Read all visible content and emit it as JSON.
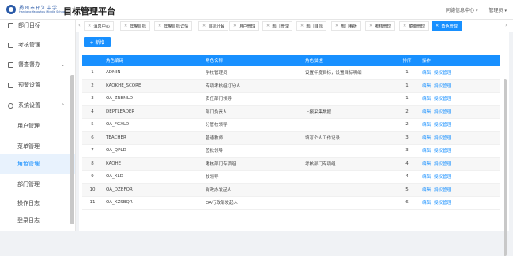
{
  "header": {
    "school_name": "扬州市邗江中学",
    "school_sub": "Hanjiang Yangzhou Middle School",
    "app_title": "目标管理平台",
    "message_center": "同德信息中心",
    "user": "管理员"
  },
  "sidebar": {
    "items": [
      {
        "label": "部门目标"
      },
      {
        "label": "考核管理"
      },
      {
        "label": "督查督办"
      },
      {
        "label": "预警设置"
      },
      {
        "label": "系统设置"
      },
      {
        "label": "用户管理"
      },
      {
        "label": "菜单管理"
      },
      {
        "label": "角色管理"
      },
      {
        "label": "部门管理"
      },
      {
        "label": "操作日志"
      },
      {
        "label": "登录日志"
      }
    ]
  },
  "tabs": [
    {
      "label": "消息中心"
    },
    {
      "label": "年度目标"
    },
    {
      "label": "年度目标详情"
    },
    {
      "label": "目标分解"
    },
    {
      "label": "用户管理"
    },
    {
      "label": "部门管理"
    },
    {
      "label": "部门目标"
    },
    {
      "label": "部门看板"
    },
    {
      "label": "考核管理"
    },
    {
      "label": "菜单管理"
    },
    {
      "label": "角色管理"
    }
  ],
  "toolbar": {
    "add_label": "+ 新增"
  },
  "table": {
    "headers": {
      "code": "角色编码",
      "name": "角色名称",
      "desc": "角色描述",
      "sort": "排序",
      "op": "操作"
    },
    "op_edit": "编辑",
    "op_auth": "授权管理",
    "rows": [
      {
        "idx": "1",
        "code": "ADMIN",
        "name": "学校管理员",
        "desc": "设置年度目标，设置目标明细",
        "sort": "1"
      },
      {
        "idx": "2",
        "code": "KAOKHE_SCORE",
        "name": "专项考核组打分人",
        "desc": "",
        "sort": "1"
      },
      {
        "idx": "3",
        "code": "OA_ZRBMLD",
        "name": "责任部门领导",
        "desc": "",
        "sort": "1"
      },
      {
        "idx": "4",
        "code": "DEPTLEADER",
        "name": "部门负责人",
        "desc": "上报采集数据",
        "sort": "2"
      },
      {
        "idx": "5",
        "code": "OA_FGXLD",
        "name": "分管校领导",
        "desc": "",
        "sort": "2"
      },
      {
        "idx": "6",
        "code": "TEACHER",
        "name": "普通教师",
        "desc": "填写个人工作记录",
        "sort": "3"
      },
      {
        "idx": "7",
        "code": "OA_QPLD",
        "name": "签批领导",
        "desc": "",
        "sort": "3"
      },
      {
        "idx": "8",
        "code": "KAOHE",
        "name": "考核部门专项组",
        "desc": "考核部门专项组",
        "sort": "4"
      },
      {
        "idx": "9",
        "code": "OA_XLD",
        "name": "校领导",
        "desc": "",
        "sort": "4"
      },
      {
        "idx": "10",
        "code": "OA_DZBFQR",
        "name": "党政办发起人",
        "desc": "",
        "sort": "5"
      },
      {
        "idx": "11",
        "code": "OA_XZSBQR",
        "name": "OA行政部发起人",
        "desc": "",
        "sort": "6"
      }
    ]
  }
}
